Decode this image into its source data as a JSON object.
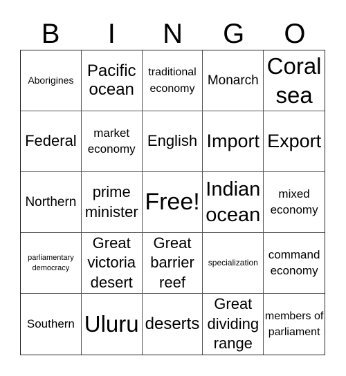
{
  "header": {
    "letters": [
      "B",
      "I",
      "N",
      "G",
      "O"
    ]
  },
  "board": {
    "rows": [
      [
        "Aborigines",
        "Pacific ocean",
        "traditional economy",
        "Monarch",
        "Coral sea"
      ],
      [
        "Federal",
        "market economy",
        "English",
        "Import",
        "Export"
      ],
      [
        "Northern",
        "prime minister",
        "Free!",
        "Indian ocean",
        "mixed economy"
      ],
      [
        "parliamentary democracy",
        "Great victoria desert",
        "Great barrier reef",
        "specialization",
        "command economy"
      ],
      [
        "Southern",
        "Uluru",
        "deserts",
        "Great dividing range",
        "members of parliament"
      ]
    ]
  }
}
